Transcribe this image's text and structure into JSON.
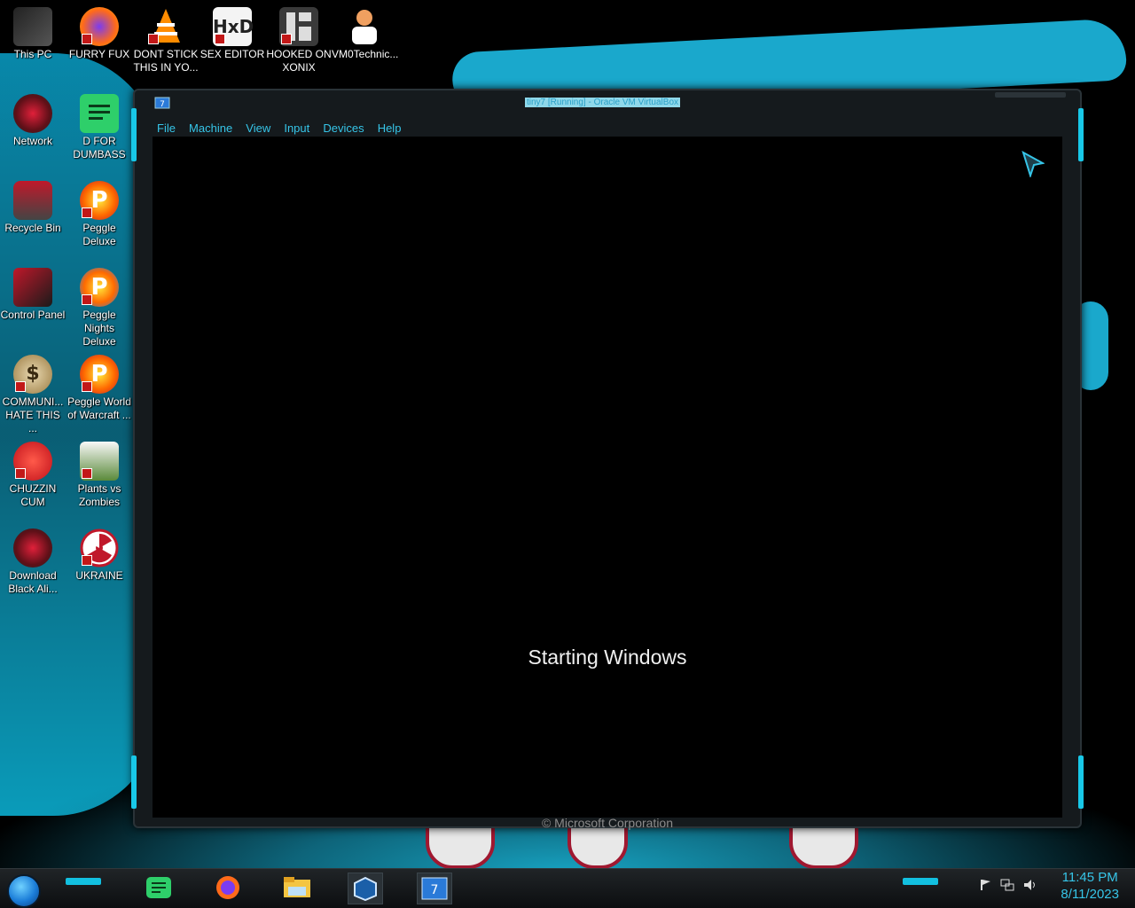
{
  "desktop": {
    "icons": [
      {
        "label": "This PC"
      },
      {
        "label": "FURRY FUX"
      },
      {
        "label": "DONT STICK THIS IN YO..."
      },
      {
        "label": "SEX EDITOR"
      },
      {
        "label": "HOOKED ON XONIX"
      },
      {
        "label": "VM0Technic..."
      },
      {
        "label": "Network"
      },
      {
        "label": "D FOR DUMBASS"
      },
      {
        "label": "Recycle Bin"
      },
      {
        "label": "Peggle Deluxe"
      },
      {
        "label": "Control Panel"
      },
      {
        "label": "Peggle Nights Deluxe"
      },
      {
        "label": "COMMUNI... HATE THIS ..."
      },
      {
        "label": "Peggle World of Warcraft ..."
      },
      {
        "label": "CHUZZIN CUM"
      },
      {
        "label": "Plants vs Zombies"
      },
      {
        "label": "Download Black Ali..."
      },
      {
        "label": "UKRAINE"
      }
    ]
  },
  "window": {
    "title": "tiny7 [Running] - Oracle VM VirtualBox",
    "menu": [
      "File",
      "Machine",
      "View",
      "Input",
      "Devices",
      "Help"
    ],
    "vm": {
      "status_text": "Starting Windows",
      "copyright": "© Microsoft Corporation"
    }
  },
  "taskbar": {
    "pinned": [
      "notes-icon",
      "firefox-icon",
      "file-explorer-icon",
      "virtualbox-icon",
      "windows7-vm-icon"
    ],
    "clock": {
      "time": "11:45 PM",
      "date": "8/11/2023"
    }
  },
  "colors": {
    "accent": "#36c5e8",
    "wallpaper_cyan": "#1aa8cc"
  }
}
